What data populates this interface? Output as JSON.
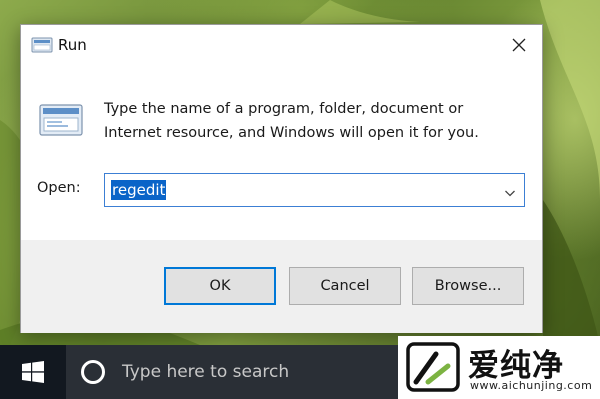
{
  "dialog": {
    "title": "Run",
    "description": "Type the name of a program, folder, document or Internet resource, and Windows will open it for you.",
    "open_label": "Open:",
    "open_value": "regedit",
    "buttons": {
      "ok": "OK",
      "cancel": "Cancel",
      "browse": "Browse..."
    },
    "icons": {
      "title": "run-app-icon",
      "close": "close-icon",
      "big": "run-app-icon",
      "dropdown": "chevron-down-icon"
    }
  },
  "taskbar": {
    "search_placeholder": "Type here to search",
    "icons": {
      "start": "windows-logo-icon",
      "search": "cortana-circle-icon"
    }
  },
  "watermark": {
    "brand": "爱纯净",
    "url": "www.aichunjing.com"
  },
  "colors": {
    "accent": "#0078d7",
    "selection": "#0a64c8",
    "taskbar": "#121820",
    "search_box": "#2a2f36"
  }
}
